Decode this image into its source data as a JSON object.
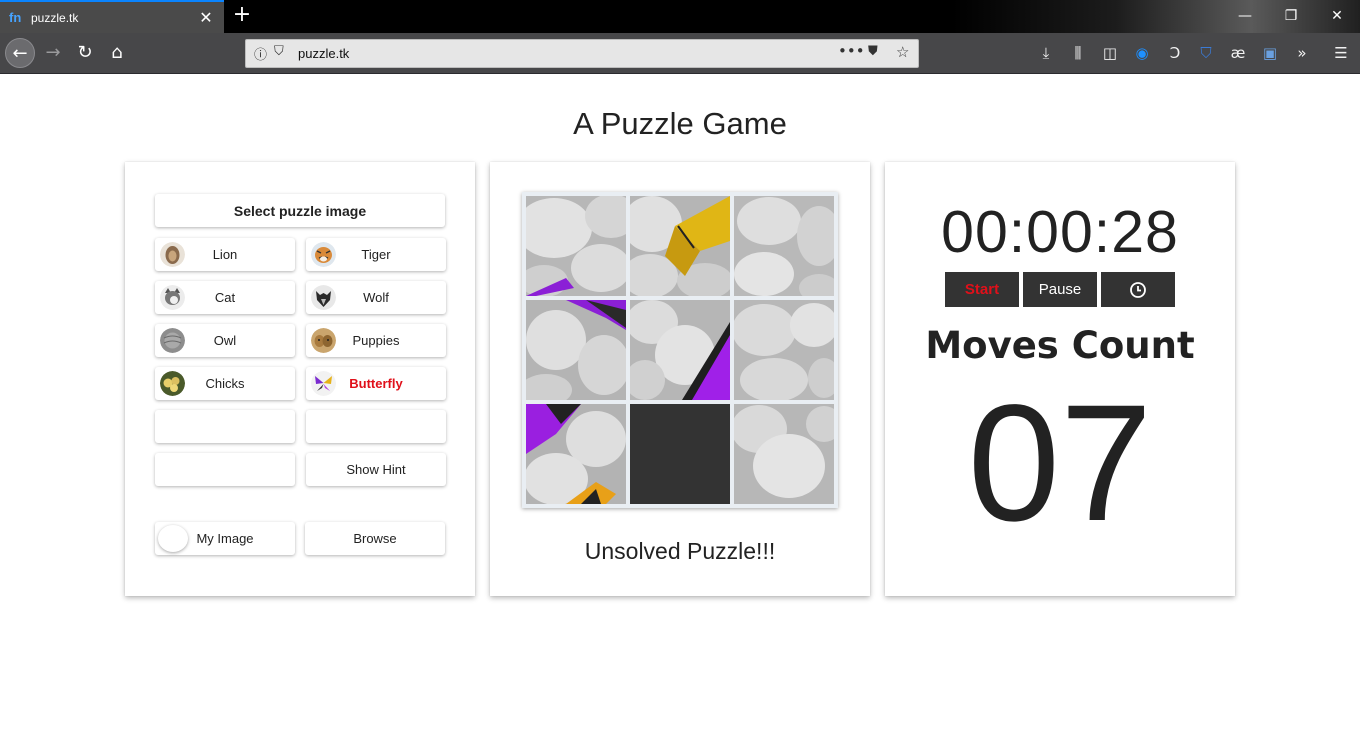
{
  "browser": {
    "tab_title": "puzzle.tk",
    "favicon_text": "fn",
    "url": "puzzle.tk"
  },
  "page": {
    "title": "A Puzzle Game"
  },
  "selector": {
    "header": "Select puzzle image",
    "images": [
      {
        "label": "Lion",
        "active": false
      },
      {
        "label": "Tiger",
        "active": false
      },
      {
        "label": "Cat",
        "active": false
      },
      {
        "label": "Wolf",
        "active": false
      },
      {
        "label": "Owl",
        "active": false
      },
      {
        "label": "Puppies",
        "active": false
      },
      {
        "label": "Chicks",
        "active": false
      },
      {
        "label": "Butterfly",
        "active": true
      }
    ],
    "hint_label": "Show Hint",
    "my_image_label": "My Image",
    "browse_label": "Browse"
  },
  "puzzle": {
    "status": "Unsolved Puzzle!!!",
    "empty_tile_index": 7
  },
  "game": {
    "timer": "00:00:28",
    "start_label": "Start",
    "pause_label": "Pause",
    "moves_title": "Moves Count",
    "moves_count": "07"
  },
  "colors": {
    "accent_red": "#e0101a",
    "dark_button": "#333333",
    "tab_accent": "#0a84ff"
  }
}
